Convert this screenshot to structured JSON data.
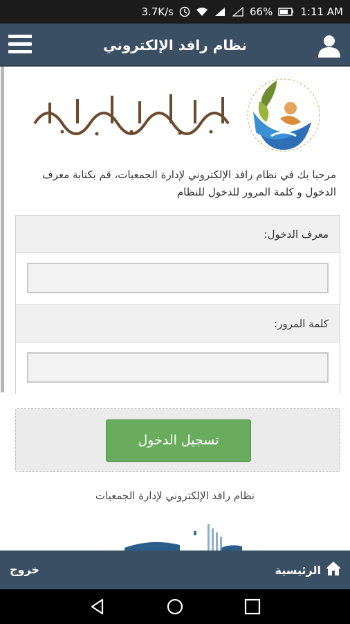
{
  "status_bar": {
    "speed": "3.7K/s",
    "battery": "66%",
    "time": "1:11 AM"
  },
  "app_bar": {
    "title": "نظام رافد الإلكتروني"
  },
  "logo": {
    "text": "جمعية البر والخدمات الاجتماعية بأملج"
  },
  "welcome": {
    "text": "مرحبا بك في نظام رافد الإلكتروني لإدارة الجمعيات، قم بكتابة معرف الدخول و كلمة المرور للدخول للنظام"
  },
  "form": {
    "username_label": "معرف الدخول:",
    "username_value": "",
    "password_label": "كلمة المرور:",
    "password_value": ""
  },
  "submit": {
    "label": "تسجيل الدخول"
  },
  "footer": {
    "text": "نظام رافد الإلكتروني لإدارة الجمعيات"
  },
  "bottom_bar": {
    "home_label": "الرئيسية",
    "logout_label": "خروج"
  },
  "colors": {
    "app_bar": "#3a4f63",
    "submit_button": "#6aac5e"
  }
}
